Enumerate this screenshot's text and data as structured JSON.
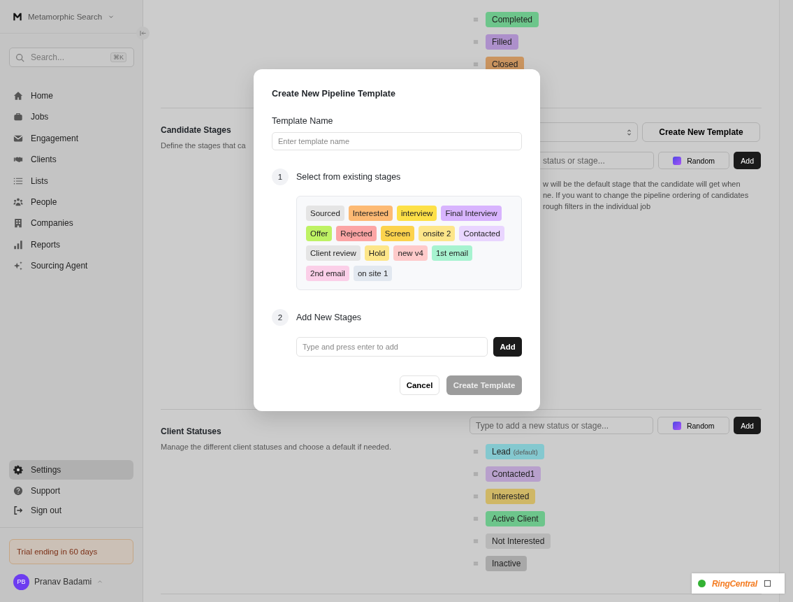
{
  "sidebar": {
    "workspace": "Metamorphic Search",
    "search": {
      "placeholder": "Search...",
      "shortcut": "⌘K"
    },
    "nav": [
      {
        "label": "Home",
        "selected": false
      },
      {
        "label": "Jobs",
        "selected": false
      },
      {
        "label": "Engagement",
        "selected": false
      },
      {
        "label": "Clients",
        "selected": false
      },
      {
        "label": "Lists",
        "selected": false
      },
      {
        "label": "People",
        "selected": false
      },
      {
        "label": "Companies",
        "selected": false
      },
      {
        "label": "Reports",
        "selected": false
      },
      {
        "label": "Sourcing Agent",
        "selected": false
      }
    ],
    "footer_nav": [
      {
        "label": "Settings",
        "selected": true
      },
      {
        "label": "Support",
        "selected": false
      },
      {
        "label": "Sign out",
        "selected": false
      }
    ],
    "trial_banner": "Trial ending in 60 days",
    "user": {
      "initials": "PB",
      "name": "Pranav Badami"
    }
  },
  "job_statuses": {
    "items": [
      {
        "label": "Completed",
        "color": "#6dc58b"
      },
      {
        "label": "Filled",
        "color": "#ad90cb"
      },
      {
        "label": "Closed",
        "color": "#cb9560"
      }
    ]
  },
  "candidate_stages": {
    "title": "Candidate Stages",
    "description": "Define the stages that ca",
    "create_template_button": "Create New Template",
    "new_status": {
      "placeholder": "status or stage..."
    },
    "random_button": "Random",
    "add_button": "Add",
    "note_lines": [
      "w will be the default stage that the candidate will get when",
      "ne. If you want to change the pipeline ordering of candidates",
      "rough filters in the individual job"
    ]
  },
  "client_statuses": {
    "title": "Client Statuses",
    "description": "Manage the different client statuses and choose a default if needed.",
    "new_status": {
      "placeholder": "Type to add a new status or stage..."
    },
    "random_button": "Random",
    "add_button": "Add",
    "items": [
      {
        "label": "Lead",
        "default_label": "(default)",
        "color": "#84c8cf"
      },
      {
        "label": "Contacted1",
        "color": "#b8a0cc"
      },
      {
        "label": "Interested",
        "color": "#cfb766"
      },
      {
        "label": "Active Client",
        "color": "#6dc58b"
      },
      {
        "label": "Not Interested",
        "color": "#b8b8b8"
      },
      {
        "label": "Inactive",
        "color": "#a8a8a8"
      }
    ]
  },
  "modal": {
    "title": "Create New Pipeline Template",
    "name_label": "Template Name",
    "name_field": {
      "placeholder": "Enter template name"
    },
    "steps": [
      {
        "number": "1",
        "title": "Select from existing stages"
      },
      {
        "number": "2",
        "title": "Add New Stages"
      }
    ],
    "existing_stages": [
      {
        "label": "Sourced",
        "color": "#e5e5e5"
      },
      {
        "label": "Interested",
        "color": "#fdba74"
      },
      {
        "label": "interview",
        "color": "#fde047"
      },
      {
        "label": "Final Interview",
        "color": "#d8b4fe"
      },
      {
        "label": "Offer",
        "color": "#bef264"
      },
      {
        "label": "Rejected",
        "color": "#fca5a5"
      },
      {
        "label": "Screen",
        "color": "#fcd34d"
      },
      {
        "label": "onsite 2",
        "color": "#fde68a"
      },
      {
        "label": "Contacted",
        "color": "#e9d5ff"
      },
      {
        "label": "Client review",
        "color": "#e5e5e5"
      },
      {
        "label": "Hold",
        "color": "#fde68a"
      },
      {
        "label": "new v4",
        "color": "#fecaca"
      },
      {
        "label": "1st email",
        "color": "#a7f3d0"
      },
      {
        "label": "2nd email",
        "color": "#fbcfe8"
      },
      {
        "label": "on site 1",
        "color": "#e2e8f0"
      }
    ],
    "new_stage_field": {
      "placeholder": "Type and press enter to add"
    },
    "add_button": "Add",
    "cancel_button": "Cancel",
    "create_button": {
      "label": "Create Template",
      "disabled": true
    }
  },
  "widget": {
    "brand": "RingCentral",
    "online": true
  }
}
